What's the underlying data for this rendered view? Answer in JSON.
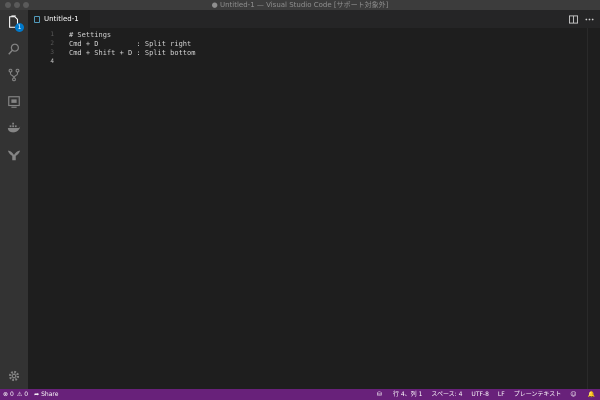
{
  "window": {
    "title": "● Untitled-1 — Visual Studio Code [サポート対象外]"
  },
  "activity_bar": {
    "items": [
      {
        "icon": "files-icon",
        "badge": "1"
      },
      {
        "icon": "search-icon"
      },
      {
        "icon": "source-control-icon"
      },
      {
        "icon": "remote-explorer-icon"
      },
      {
        "icon": "docker-icon"
      },
      {
        "icon": "gitlens-icon"
      }
    ],
    "manage_icon": "gear-icon"
  },
  "tabs": [
    {
      "label": "Untitled-1",
      "active": true
    }
  ],
  "editor": {
    "lines": [
      {
        "number": "1",
        "text": "# Settings"
      },
      {
        "number": "2",
        "text": "Cmd + D         : Split right"
      },
      {
        "number": "3",
        "text": "Cmd + Shift + D : Split bottom"
      },
      {
        "number": "4",
        "text": ""
      }
    ],
    "active_line": "4"
  },
  "status_bar": {
    "errors": "0",
    "warnings": "0",
    "share": "Share",
    "position": "行 4、列 1",
    "indent": "スペース: 4",
    "encoding": "UTF-8",
    "eol": "LF",
    "language": "プレーンテキスト"
  },
  "colors": {
    "status_bar": "#68217a",
    "activity_bar": "#333333",
    "editor_bg": "#1e1e1e",
    "badge": "#007acc"
  }
}
